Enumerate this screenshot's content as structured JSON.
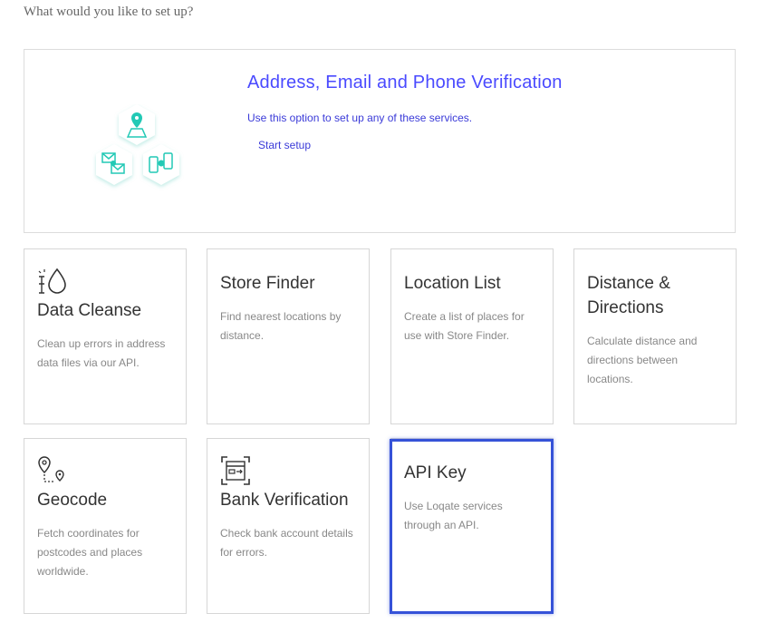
{
  "prompt": "What would you like to set up?",
  "hero": {
    "title": "Address, Email and Phone Verification",
    "description": "Use this option to set up any of these services.",
    "link": "Start setup",
    "icon_color": "#22c9b5"
  },
  "cards": [
    {
      "id": "data-cleanse",
      "title": "Data Cleanse",
      "description": "Clean up errors in address data files via our API.",
      "icon": "droplet-icon"
    },
    {
      "id": "store-finder",
      "title": "Store Finder",
      "description": "Find nearest locations by distance.",
      "icon": ""
    },
    {
      "id": "location-list",
      "title": "Location List",
      "description": "Create a list of places for use with Store Finder.",
      "icon": ""
    },
    {
      "id": "distance-directions",
      "title": "Distance & Directions",
      "description": "Calculate distance and directions between locations.",
      "icon": ""
    },
    {
      "id": "geocode",
      "title": "Geocode",
      "description": "Fetch coordinates for postcodes and places worldwide.",
      "icon": "map-pin-route-icon"
    },
    {
      "id": "bank-verification",
      "title": "Bank Verification",
      "description": "Check bank account details for errors.",
      "icon": "card-scan-icon"
    },
    {
      "id": "api-key",
      "title": "API Key",
      "description": "Use Loqate services through an API.",
      "icon": "",
      "highlighted": true
    }
  ],
  "colors": {
    "accent": "#4a4aff",
    "highlight": "#3552d8",
    "teal": "#22c9b5"
  }
}
